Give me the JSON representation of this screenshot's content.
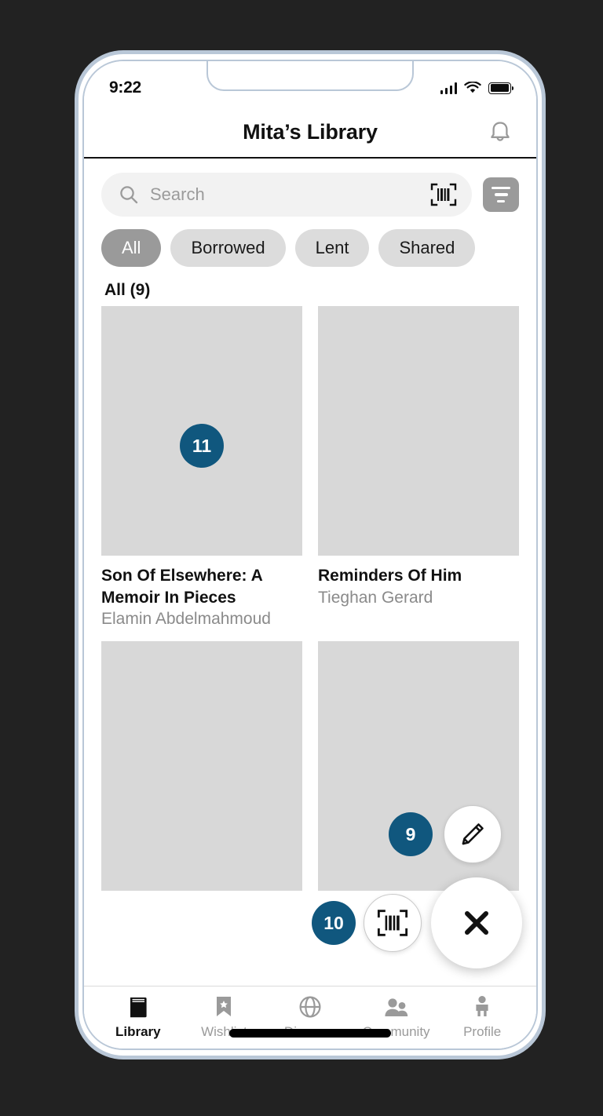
{
  "status_bar": {
    "time": "9:22",
    "signal_icon": "signal-bars-icon",
    "wifi_icon": "wifi-icon",
    "battery_icon": "battery-full-icon"
  },
  "header": {
    "title": "Mita’s Library",
    "bell_icon": "notification-bell-icon"
  },
  "search": {
    "placeholder": "Search",
    "value": "",
    "search_icon": "search-icon",
    "barcode_icon": "barcode-scan-icon",
    "filter_icon": "filter-icon"
  },
  "chips": [
    {
      "label": "All",
      "active": true
    },
    {
      "label": "Borrowed",
      "active": false
    },
    {
      "label": "Lent",
      "active": false
    },
    {
      "label": "Shared",
      "active": false
    }
  ],
  "section": {
    "label": "All (9)"
  },
  "books": [
    {
      "title": "Son Of Elsewhere: A Memoir In Pieces",
      "author": "Elamin Abdelmahmoud",
      "badge": "11"
    },
    {
      "title": "Reminders Of Him",
      "author": "Tieghan Gerard",
      "badge": ""
    },
    {
      "title": "",
      "author": "",
      "badge": ""
    },
    {
      "title": "",
      "author": "",
      "badge": ""
    }
  ],
  "fab": {
    "edit_badge": "9",
    "scan_badge": "10",
    "edit_icon": "pencil-edit-icon",
    "scan_icon": "barcode-scan-icon",
    "close_icon": "close-x-icon"
  },
  "bottom_nav": [
    {
      "label": "Library",
      "icon": "book-icon",
      "active": true
    },
    {
      "label": "Wishlist",
      "icon": "bookmark-star-icon",
      "active": false
    },
    {
      "label": "Discover",
      "icon": "globe-icon",
      "active": false
    },
    {
      "label": "Community",
      "icon": "people-icon",
      "active": false
    },
    {
      "label": "Profile",
      "icon": "person-icon",
      "active": false
    }
  ],
  "colors": {
    "badge": "#10577E",
    "chip_active": "#9A9A9A",
    "chip_idle": "#DCDCDC",
    "placeholder_cover": "#D8D8D8",
    "frame": "#B9C7D7",
    "backdrop": "#222222"
  }
}
